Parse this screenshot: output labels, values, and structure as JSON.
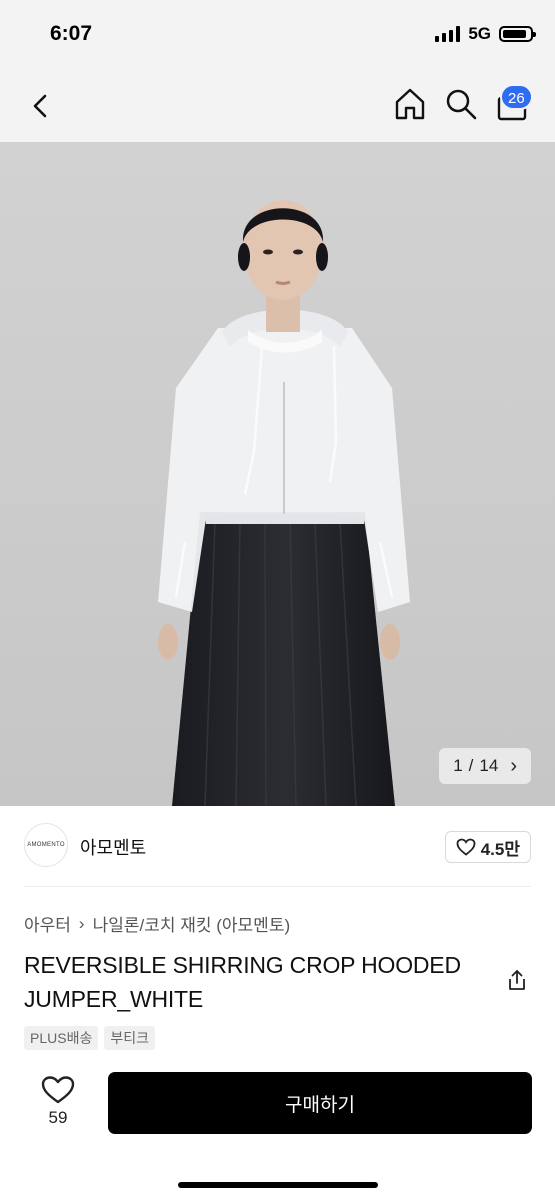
{
  "status": {
    "time": "6:07",
    "network": "5G",
    "battery_level": 0.9
  },
  "nav": {
    "cart_count": "26"
  },
  "gallery": {
    "current": "1",
    "separator": "/",
    "total": "14",
    "next_glyph": "›"
  },
  "brand": {
    "logo_text": "AMOMENTO",
    "name": "아모멘토",
    "likes": "4.5만"
  },
  "product": {
    "breadcrumb": [
      "아우터",
      "나일론/코치 재킷 (아모멘토)"
    ],
    "breadcrumb_sep": "›",
    "title": "REVERSIBLE SHIRRING CROP HOODED JUMPER_WHITE",
    "tags": [
      "PLUS배송",
      "부티크"
    ]
  },
  "bottom_bar": {
    "wish_count": "59",
    "buy_label": "구매하기"
  },
  "colors": {
    "accent": "#2f6df0",
    "buy_button": "#000000",
    "header_bg": "#f3f3f3"
  }
}
